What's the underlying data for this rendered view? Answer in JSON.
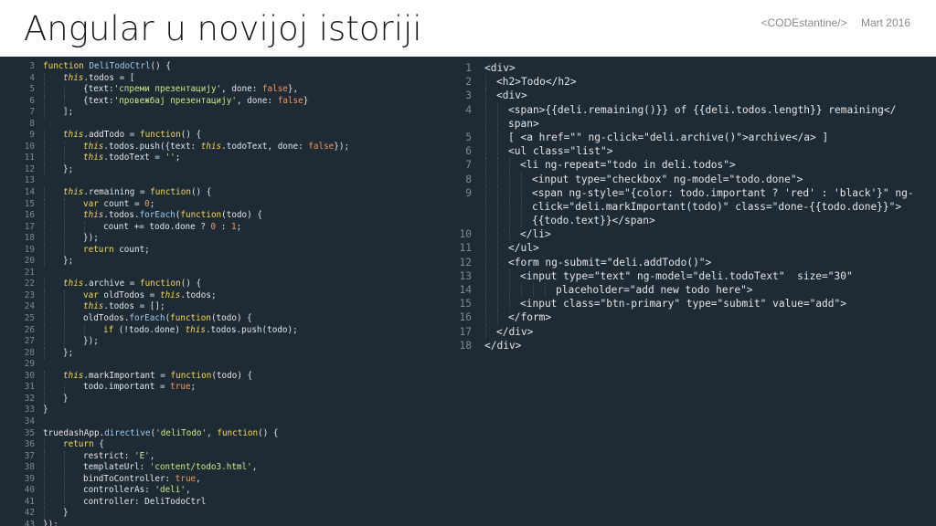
{
  "slide": {
    "title": "Angular u novijoj istoriji",
    "org": "<CODEstantine/>",
    "date": "Mart 2016"
  },
  "colors": {
    "background": "#ffffff",
    "editor_bg": "#1e2a34",
    "default": "#e6e6e6",
    "keyword": "#f7d75a",
    "property": "#f7d75a",
    "function": "#9fcbed",
    "string": "#cfe88a",
    "number": "#f29a5e",
    "boolean": "#f29a5e",
    "this": "#f7d75a",
    "comment": "#7d8a95",
    "line_number": "#7d8a95"
  },
  "left_code": [
    {
      "n": "3",
      "i": 0,
      "t": [
        [
          "kw",
          "function "
        ],
        [
          "fn",
          "DeliTodoCtrl"
        ],
        [
          "",
          "() {"
        ]
      ]
    },
    {
      "n": "4",
      "i": 1,
      "t": [
        [
          "th",
          "this"
        ],
        [
          "",
          ".todos = ["
        ]
      ]
    },
    {
      "n": "5",
      "i": 2,
      "t": [
        [
          "",
          "{text:"
        ],
        [
          "str",
          "'спреми презентацију'"
        ],
        [
          "",
          ", done: "
        ],
        [
          "bool",
          "false"
        ],
        [
          "",
          "},"
        ]
      ]
    },
    {
      "n": "6",
      "i": 2,
      "t": [
        [
          "",
          "{text:"
        ],
        [
          "str",
          "'провежбај презентацију'"
        ],
        [
          "",
          ", done: "
        ],
        [
          "bool",
          "false"
        ],
        [
          "",
          "}"
        ]
      ]
    },
    {
      "n": "7",
      "i": 1,
      "t": [
        [
          "",
          "];"
        ]
      ]
    },
    {
      "n": "8",
      "i": 0,
      "t": []
    },
    {
      "n": "9",
      "i": 1,
      "t": [
        [
          "th",
          "this"
        ],
        [
          "",
          ".addTodo = "
        ],
        [
          "kw",
          "function"
        ],
        [
          "",
          "() {"
        ]
      ]
    },
    {
      "n": "10",
      "i": 2,
      "t": [
        [
          "th",
          "this"
        ],
        [
          "",
          ".todos.push({text: "
        ],
        [
          "th",
          "this"
        ],
        [
          "",
          ".todoText, done: "
        ],
        [
          "bool",
          "false"
        ],
        [
          "",
          "});"
        ]
      ]
    },
    {
      "n": "11",
      "i": 2,
      "t": [
        [
          "th",
          "this"
        ],
        [
          "",
          ".todoText = "
        ],
        [
          "str",
          "''"
        ],
        [
          "",
          ";"
        ]
      ]
    },
    {
      "n": "12",
      "i": 1,
      "t": [
        [
          "",
          "};"
        ]
      ]
    },
    {
      "n": "13",
      "i": 0,
      "t": []
    },
    {
      "n": "14",
      "i": 1,
      "t": [
        [
          "th",
          "this"
        ],
        [
          "",
          ".remaining = "
        ],
        [
          "kw",
          "function"
        ],
        [
          "",
          "() {"
        ]
      ]
    },
    {
      "n": "15",
      "i": 2,
      "t": [
        [
          "kw",
          "var "
        ],
        [
          "",
          "count = "
        ],
        [
          "num",
          "0"
        ],
        [
          "",
          ";"
        ]
      ]
    },
    {
      "n": "16",
      "i": 2,
      "t": [
        [
          "th",
          "this"
        ],
        [
          "",
          ".todos."
        ],
        [
          "fn",
          "forEach"
        ],
        [
          "",
          "("
        ],
        [
          "kw",
          "function"
        ],
        [
          "",
          "(todo) {"
        ]
      ]
    },
    {
      "n": "17",
      "i": 3,
      "t": [
        [
          "",
          "count += todo.done ? "
        ],
        [
          "num",
          "0"
        ],
        [
          "",
          " : "
        ],
        [
          "num",
          "1"
        ],
        [
          "",
          ";"
        ]
      ]
    },
    {
      "n": "18",
      "i": 2,
      "t": [
        [
          "",
          "});"
        ]
      ]
    },
    {
      "n": "19",
      "i": 2,
      "t": [
        [
          "kw",
          "return "
        ],
        [
          "",
          "count;"
        ]
      ]
    },
    {
      "n": "20",
      "i": 1,
      "t": [
        [
          "",
          "};"
        ]
      ]
    },
    {
      "n": "21",
      "i": 0,
      "t": []
    },
    {
      "n": "22",
      "i": 1,
      "t": [
        [
          "th",
          "this"
        ],
        [
          "",
          ".archive = "
        ],
        [
          "kw",
          "function"
        ],
        [
          "",
          "() {"
        ]
      ]
    },
    {
      "n": "23",
      "i": 2,
      "t": [
        [
          "kw",
          "var "
        ],
        [
          "",
          "oldTodos = "
        ],
        [
          "th",
          "this"
        ],
        [
          "",
          ".todos;"
        ]
      ]
    },
    {
      "n": "24",
      "i": 2,
      "t": [
        [
          "th",
          "this"
        ],
        [
          "",
          ".todos = [];"
        ]
      ]
    },
    {
      "n": "25",
      "i": 2,
      "t": [
        [
          "",
          "oldTodos."
        ],
        [
          "fn",
          "forEach"
        ],
        [
          "",
          "("
        ],
        [
          "kw",
          "function"
        ],
        [
          "",
          "(todo) {"
        ]
      ]
    },
    {
      "n": "26",
      "i": 3,
      "t": [
        [
          "kw",
          "if "
        ],
        [
          "",
          "(!todo.done) "
        ],
        [
          "th",
          "this"
        ],
        [
          "",
          ".todos.push(todo);"
        ]
      ]
    },
    {
      "n": "27",
      "i": 2,
      "t": [
        [
          "",
          "});"
        ]
      ]
    },
    {
      "n": "28",
      "i": 1,
      "t": [
        [
          "",
          "};"
        ]
      ]
    },
    {
      "n": "29",
      "i": 0,
      "t": []
    },
    {
      "n": "30",
      "i": 1,
      "t": [
        [
          "th",
          "this"
        ],
        [
          "",
          ".markImportant = "
        ],
        [
          "kw",
          "function"
        ],
        [
          "",
          "(todo) {"
        ]
      ]
    },
    {
      "n": "31",
      "i": 2,
      "t": [
        [
          "",
          "todo.important = "
        ],
        [
          "bool",
          "true"
        ],
        [
          "",
          ";"
        ]
      ]
    },
    {
      "n": "32",
      "i": 1,
      "t": [
        [
          "",
          "}"
        ]
      ]
    },
    {
      "n": "33",
      "i": 0,
      "t": [
        [
          "",
          "}"
        ]
      ]
    },
    {
      "n": "34",
      "i": 0,
      "t": []
    },
    {
      "n": "35",
      "i": 0,
      "t": [
        [
          "",
          "truedashApp."
        ],
        [
          "fn",
          "directive"
        ],
        [
          "",
          "("
        ],
        [
          "str",
          "'deliTodo'"
        ],
        [
          "",
          ", "
        ],
        [
          "kw",
          "function"
        ],
        [
          "",
          "() {"
        ]
      ]
    },
    {
      "n": "36",
      "i": 1,
      "t": [
        [
          "kw",
          "return "
        ],
        [
          "",
          "{"
        ]
      ]
    },
    {
      "n": "37",
      "i": 2,
      "t": [
        [
          "",
          "restrict: "
        ],
        [
          "str",
          "'E'"
        ],
        [
          "",
          ","
        ]
      ]
    },
    {
      "n": "38",
      "i": 2,
      "t": [
        [
          "",
          "templateUrl: "
        ],
        [
          "str",
          "'content/todo3.html'"
        ],
        [
          "",
          ","
        ]
      ]
    },
    {
      "n": "39",
      "i": 2,
      "t": [
        [
          "",
          "bindToController: "
        ],
        [
          "bool",
          "true"
        ],
        [
          "",
          ","
        ]
      ]
    },
    {
      "n": "40",
      "i": 2,
      "t": [
        [
          "",
          "controllerAs: "
        ],
        [
          "str",
          "'deli'"
        ],
        [
          "",
          ","
        ]
      ]
    },
    {
      "n": "41",
      "i": 2,
      "t": [
        [
          "",
          "controller: DeliTodoCtrl"
        ]
      ]
    },
    {
      "n": "42",
      "i": 1,
      "t": [
        [
          "",
          "}"
        ]
      ]
    },
    {
      "n": "43",
      "i": 0,
      "t": [
        [
          "",
          "});"
        ]
      ]
    }
  ],
  "right_code": [
    {
      "n": "1",
      "i": 0,
      "t": [
        [
          "",
          "<div>"
        ]
      ]
    },
    {
      "n": "2",
      "i": 1,
      "t": [
        [
          "",
          "<h2>Todo</h2>"
        ]
      ]
    },
    {
      "n": "3",
      "i": 1,
      "t": [
        [
          "",
          "<div>"
        ]
      ]
    },
    {
      "n": "4",
      "i": 2,
      "t": [
        [
          "",
          "<span>{{deli.remaining()}} of {{deli.todos.length}} remaining</"
        ]
      ]
    },
    {
      "n": "",
      "i": 2,
      "t": [
        [
          "",
          "span>"
        ]
      ]
    },
    {
      "n": "5",
      "i": 2,
      "t": [
        [
          "",
          "[ <a href=\"\" ng-click=\"deli.archive()\">archive</a> ]"
        ]
      ]
    },
    {
      "n": "6",
      "i": 2,
      "t": [
        [
          "",
          "<ul class=\"list\">"
        ]
      ]
    },
    {
      "n": "7",
      "i": 3,
      "t": [
        [
          "",
          "<li ng-repeat=\"todo in deli.todos\">"
        ]
      ]
    },
    {
      "n": "8",
      "i": 4,
      "t": [
        [
          "",
          "<input type=\"checkbox\" ng-model=\"todo.done\">"
        ]
      ]
    },
    {
      "n": "9",
      "i": 4,
      "t": [
        [
          "",
          "<span ng-style=\"{color: todo.important ? 'red' : 'black'}\" ng-"
        ]
      ]
    },
    {
      "n": "",
      "i": 4,
      "t": [
        [
          "",
          "click=\"deli.markImportant(todo)\" class=\"done-{{todo.done}}\">"
        ]
      ]
    },
    {
      "n": "",
      "i": 4,
      "t": [
        [
          "",
          "{{todo.text}}</span>"
        ]
      ]
    },
    {
      "n": "10",
      "i": 3,
      "t": [
        [
          "",
          "</li>"
        ]
      ]
    },
    {
      "n": "11",
      "i": 2,
      "t": [
        [
          "",
          "</ul>"
        ]
      ]
    },
    {
      "n": "12",
      "i": 2,
      "t": [
        [
          "",
          "<form ng-submit=\"deli.addTodo()\">"
        ]
      ]
    },
    {
      "n": "13",
      "i": 3,
      "t": [
        [
          "",
          "<input type=\"text\" ng-model=\"deli.todoText\"  size=\"30\""
        ]
      ]
    },
    {
      "n": "14",
      "i": 6,
      "t": [
        [
          "",
          "placeholder=\"add new todo here\">"
        ]
      ]
    },
    {
      "n": "15",
      "i": 3,
      "t": [
        [
          "",
          "<input class=\"btn-primary\" type=\"submit\" value=\"add\">"
        ]
      ]
    },
    {
      "n": "16",
      "i": 2,
      "t": [
        [
          "",
          "</form>"
        ]
      ]
    },
    {
      "n": "17",
      "i": 1,
      "t": [
        [
          "",
          "</div>"
        ]
      ]
    },
    {
      "n": "18",
      "i": 0,
      "t": [
        [
          "",
          "</div>"
        ]
      ]
    }
  ]
}
